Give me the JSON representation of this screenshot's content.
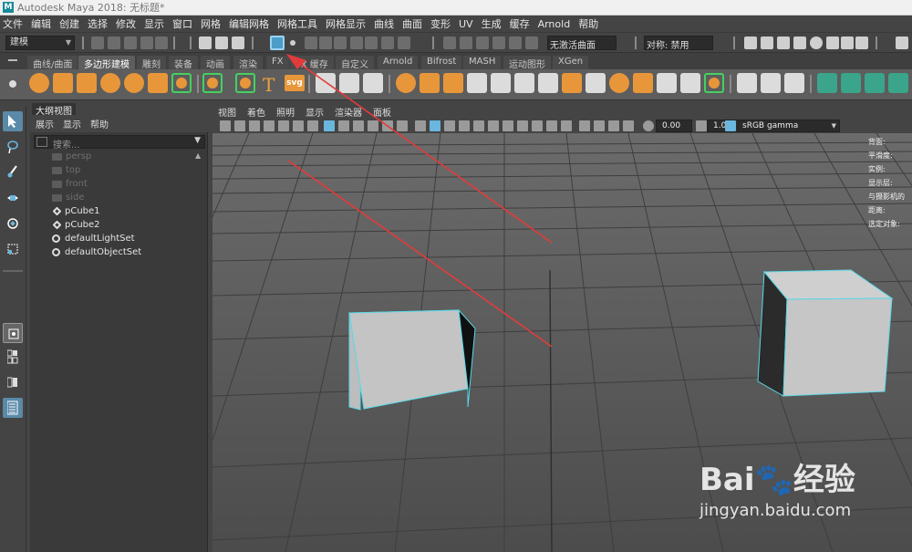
{
  "window": {
    "title": "Autodesk Maya 2018: 无标题*",
    "logo_letter": "M"
  },
  "menubar": {
    "items": [
      "文件",
      "编辑",
      "创建",
      "选择",
      "修改",
      "显示",
      "窗口",
      "网格",
      "编辑网格",
      "网格工具",
      "网格显示",
      "曲线",
      "曲面",
      "变形",
      "UV",
      "生成",
      "缓存",
      "Arnold",
      "帮助"
    ]
  },
  "statusline": {
    "mode": "建模",
    "surface_field": "无激活曲面",
    "symmetry_field": "对称: 禁用"
  },
  "shelf": {
    "tabs": [
      "曲线/曲面",
      "多边形建模",
      "雕刻",
      "装备",
      "动画",
      "渲染",
      "FX",
      "FX 缓存",
      "自定义",
      "Arnold",
      "Bifrost",
      "MASH",
      "运动图形",
      "XGen"
    ],
    "active_tab": "多边形建模",
    "type_tool_glyph": "T",
    "svg_tool_label": "svg"
  },
  "outliner": {
    "panel_title": "大纲视图",
    "menu": [
      "展示",
      "显示",
      "帮助"
    ],
    "search_placeholder": "搜索...",
    "items": [
      {
        "label": "persp",
        "kind": "camera",
        "dim": true
      },
      {
        "label": "top",
        "kind": "camera",
        "dim": true
      },
      {
        "label": "front",
        "kind": "camera",
        "dim": true
      },
      {
        "label": "side",
        "kind": "camera",
        "dim": true
      },
      {
        "label": "pCube1",
        "kind": "mesh",
        "dim": false
      },
      {
        "label": "pCube2",
        "kind": "mesh",
        "dim": false
      },
      {
        "label": "defaultLightSet",
        "kind": "set",
        "dim": false
      },
      {
        "label": "defaultObjectSet",
        "kind": "set",
        "dim": false
      }
    ]
  },
  "viewport": {
    "menu": [
      "视图",
      "着色",
      "照明",
      "显示",
      "渲染器",
      "面板"
    ],
    "exposure_value": "0.00",
    "gamma_value": "1.00",
    "color_space": "sRGB gamma",
    "hud_lines": [
      "背面:",
      "平滑度:",
      "实例:",
      "显示层:",
      "与摄影机的距离:",
      "选定对象:"
    ]
  },
  "watermark": {
    "logo_text": "Bai🐾经验",
    "url": "jingyan.baidu.com"
  },
  "colors": {
    "annotation_arrow": "#e33b3b",
    "selection_outline": "#5ad8e8",
    "shelf_orange": "#e8963a",
    "accent_blue": "#4c9ec9"
  }
}
